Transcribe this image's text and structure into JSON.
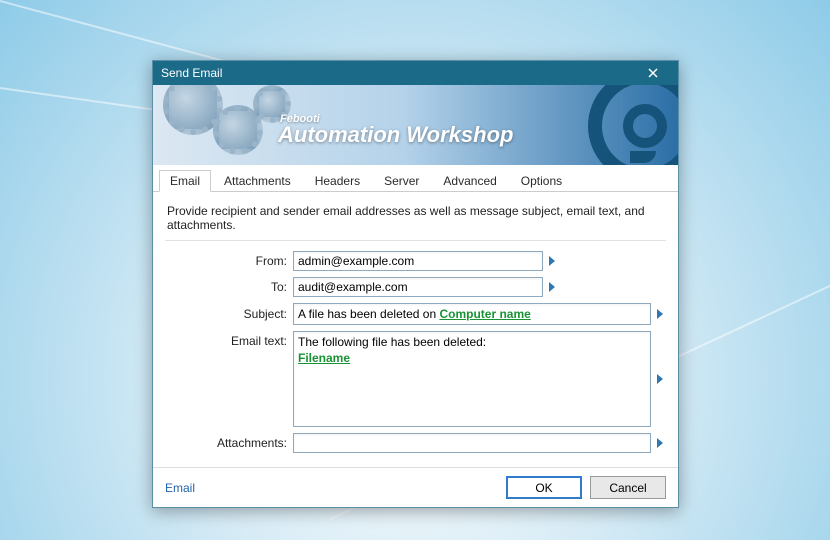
{
  "window": {
    "title": "Send Email"
  },
  "banner": {
    "sub": "Febooti",
    "main": "Automation Workshop"
  },
  "tabs": [
    "Email",
    "Attachments",
    "Headers",
    "Server",
    "Advanced",
    "Options"
  ],
  "active_tab": 0,
  "instruction": "Provide recipient and sender email addresses as well as message subject, email text, and attachments.",
  "labels": {
    "from": "From:",
    "to": "To:",
    "subject": "Subject:",
    "emailtext": "Email text:",
    "attachments": "Attachments:"
  },
  "values": {
    "from": "admin@example.com",
    "to": "audit@example.com",
    "subject_prefix": "A file has been deleted on ",
    "subject_variable": "Computer name",
    "body_line": "The following file has been deleted:",
    "body_variable": "Filename",
    "attachments": ""
  },
  "footer": {
    "link": "Email",
    "ok": "OK",
    "cancel": "Cancel"
  }
}
